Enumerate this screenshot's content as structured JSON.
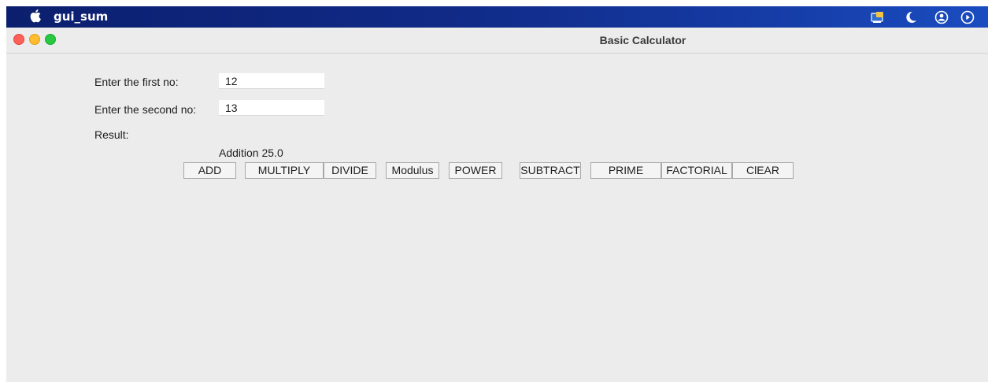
{
  "menubar": {
    "app_name": "gui_sum",
    "tray_icons": [
      "window-icon",
      "moon-icon",
      "user-icon",
      "play-icon"
    ]
  },
  "window": {
    "title": "Basic Calculator"
  },
  "form": {
    "first_label": "Enter the first no:",
    "first_value": "12",
    "second_label": "Enter the second no:",
    "second_value": "13",
    "result_label": "Result:",
    "result_text": "Addition 25.0"
  },
  "buttons": {
    "add": "ADD",
    "multiply": "MULTIPLY",
    "divide": "DIVIDE",
    "modulus": "Modulus",
    "power": "POWER",
    "subtract": "SUBTRACT",
    "prime": "PRIME",
    "factorial": "FACTORIAL",
    "clear": "ClEAR"
  }
}
